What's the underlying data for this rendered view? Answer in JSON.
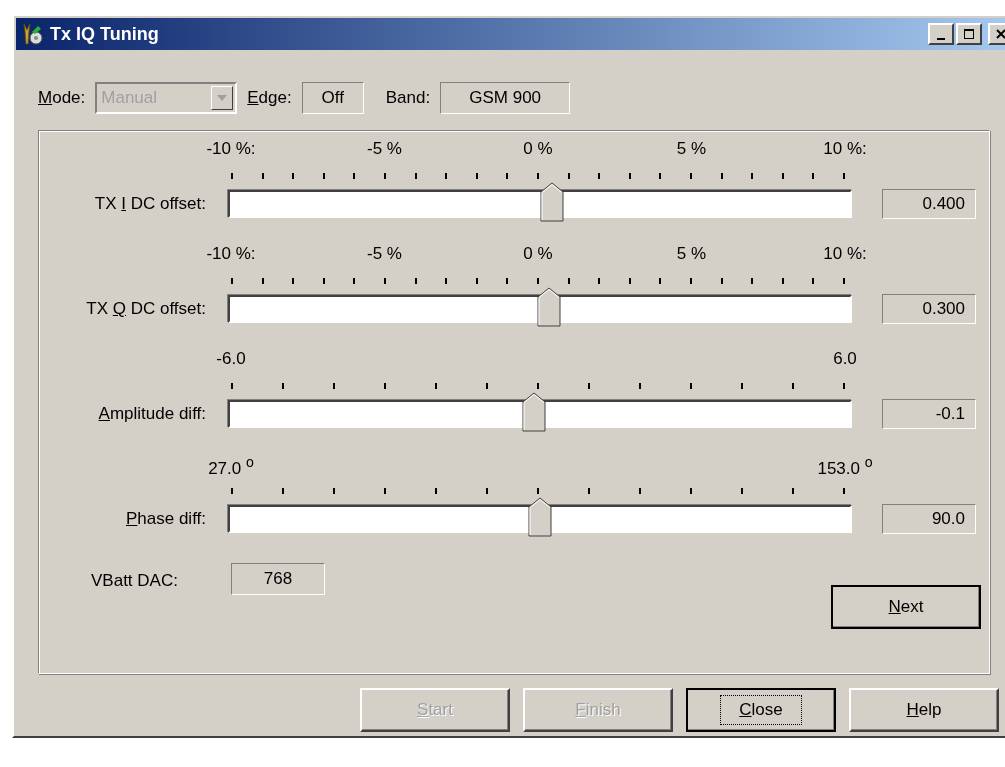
{
  "window": {
    "title": "Tx IQ Tuning"
  },
  "header": {
    "mode": {
      "label": {
        "key": "M",
        "tail": "ode:"
      },
      "value": "Manual",
      "disabled": true
    },
    "edge": {
      "label": {
        "key": "E",
        "tail": "dge:"
      },
      "value": "Off"
    },
    "band": {
      "label": "Band:",
      "value": "GSM 900"
    }
  },
  "sliders": [
    {
      "label": {
        "lead": "TX ",
        "key": "I",
        "tail": " DC offset:"
      },
      "scale": [
        "-10 %:",
        "-5 %",
        "0 %",
        "5 %",
        "10 %:"
      ],
      "level": 0.52,
      "value": "0.400"
    },
    {
      "label": {
        "lead": "TX ",
        "key": "Q",
        "tail": " DC offset:"
      },
      "scale": [
        "-10 %:",
        "-5 %",
        "0 %",
        "5 %",
        "10 %:"
      ],
      "level": 0.515,
      "value": "0.300"
    },
    {
      "label": {
        "key": "A",
        "tail": "mplitude diff:"
      },
      "scale": [
        "-6.0",
        "6.0"
      ],
      "level": 0.49,
      "value": "-0.1"
    },
    {
      "label": {
        "key": "P",
        "tail": "hase diff:"
      },
      "scale": [
        "27.0 $^{o}$",
        "153.0 $^{o}$"
      ],
      "level": 0.5,
      "value": "90.0"
    }
  ],
  "vbatt": {
    "label": "VBatt DAC:",
    "value": "768"
  },
  "next_button": {
    "label": {
      "key": "N",
      "tail": "ext"
    },
    "disabled": false
  },
  "buttons": [
    {
      "label": {
        "key": "S",
        "tail": "tart"
      },
      "disabled": true,
      "focused": false
    },
    {
      "label": {
        "key": "F",
        "tail": "inish"
      },
      "disabled": true,
      "focused": false
    },
    {
      "label": {
        "key": "C",
        "tail": "lose"
      },
      "disabled": false,
      "focused": true
    },
    {
      "label": {
        "key": "H",
        "tail": "elp"
      },
      "disabled": false,
      "focused": false
    }
  ]
}
